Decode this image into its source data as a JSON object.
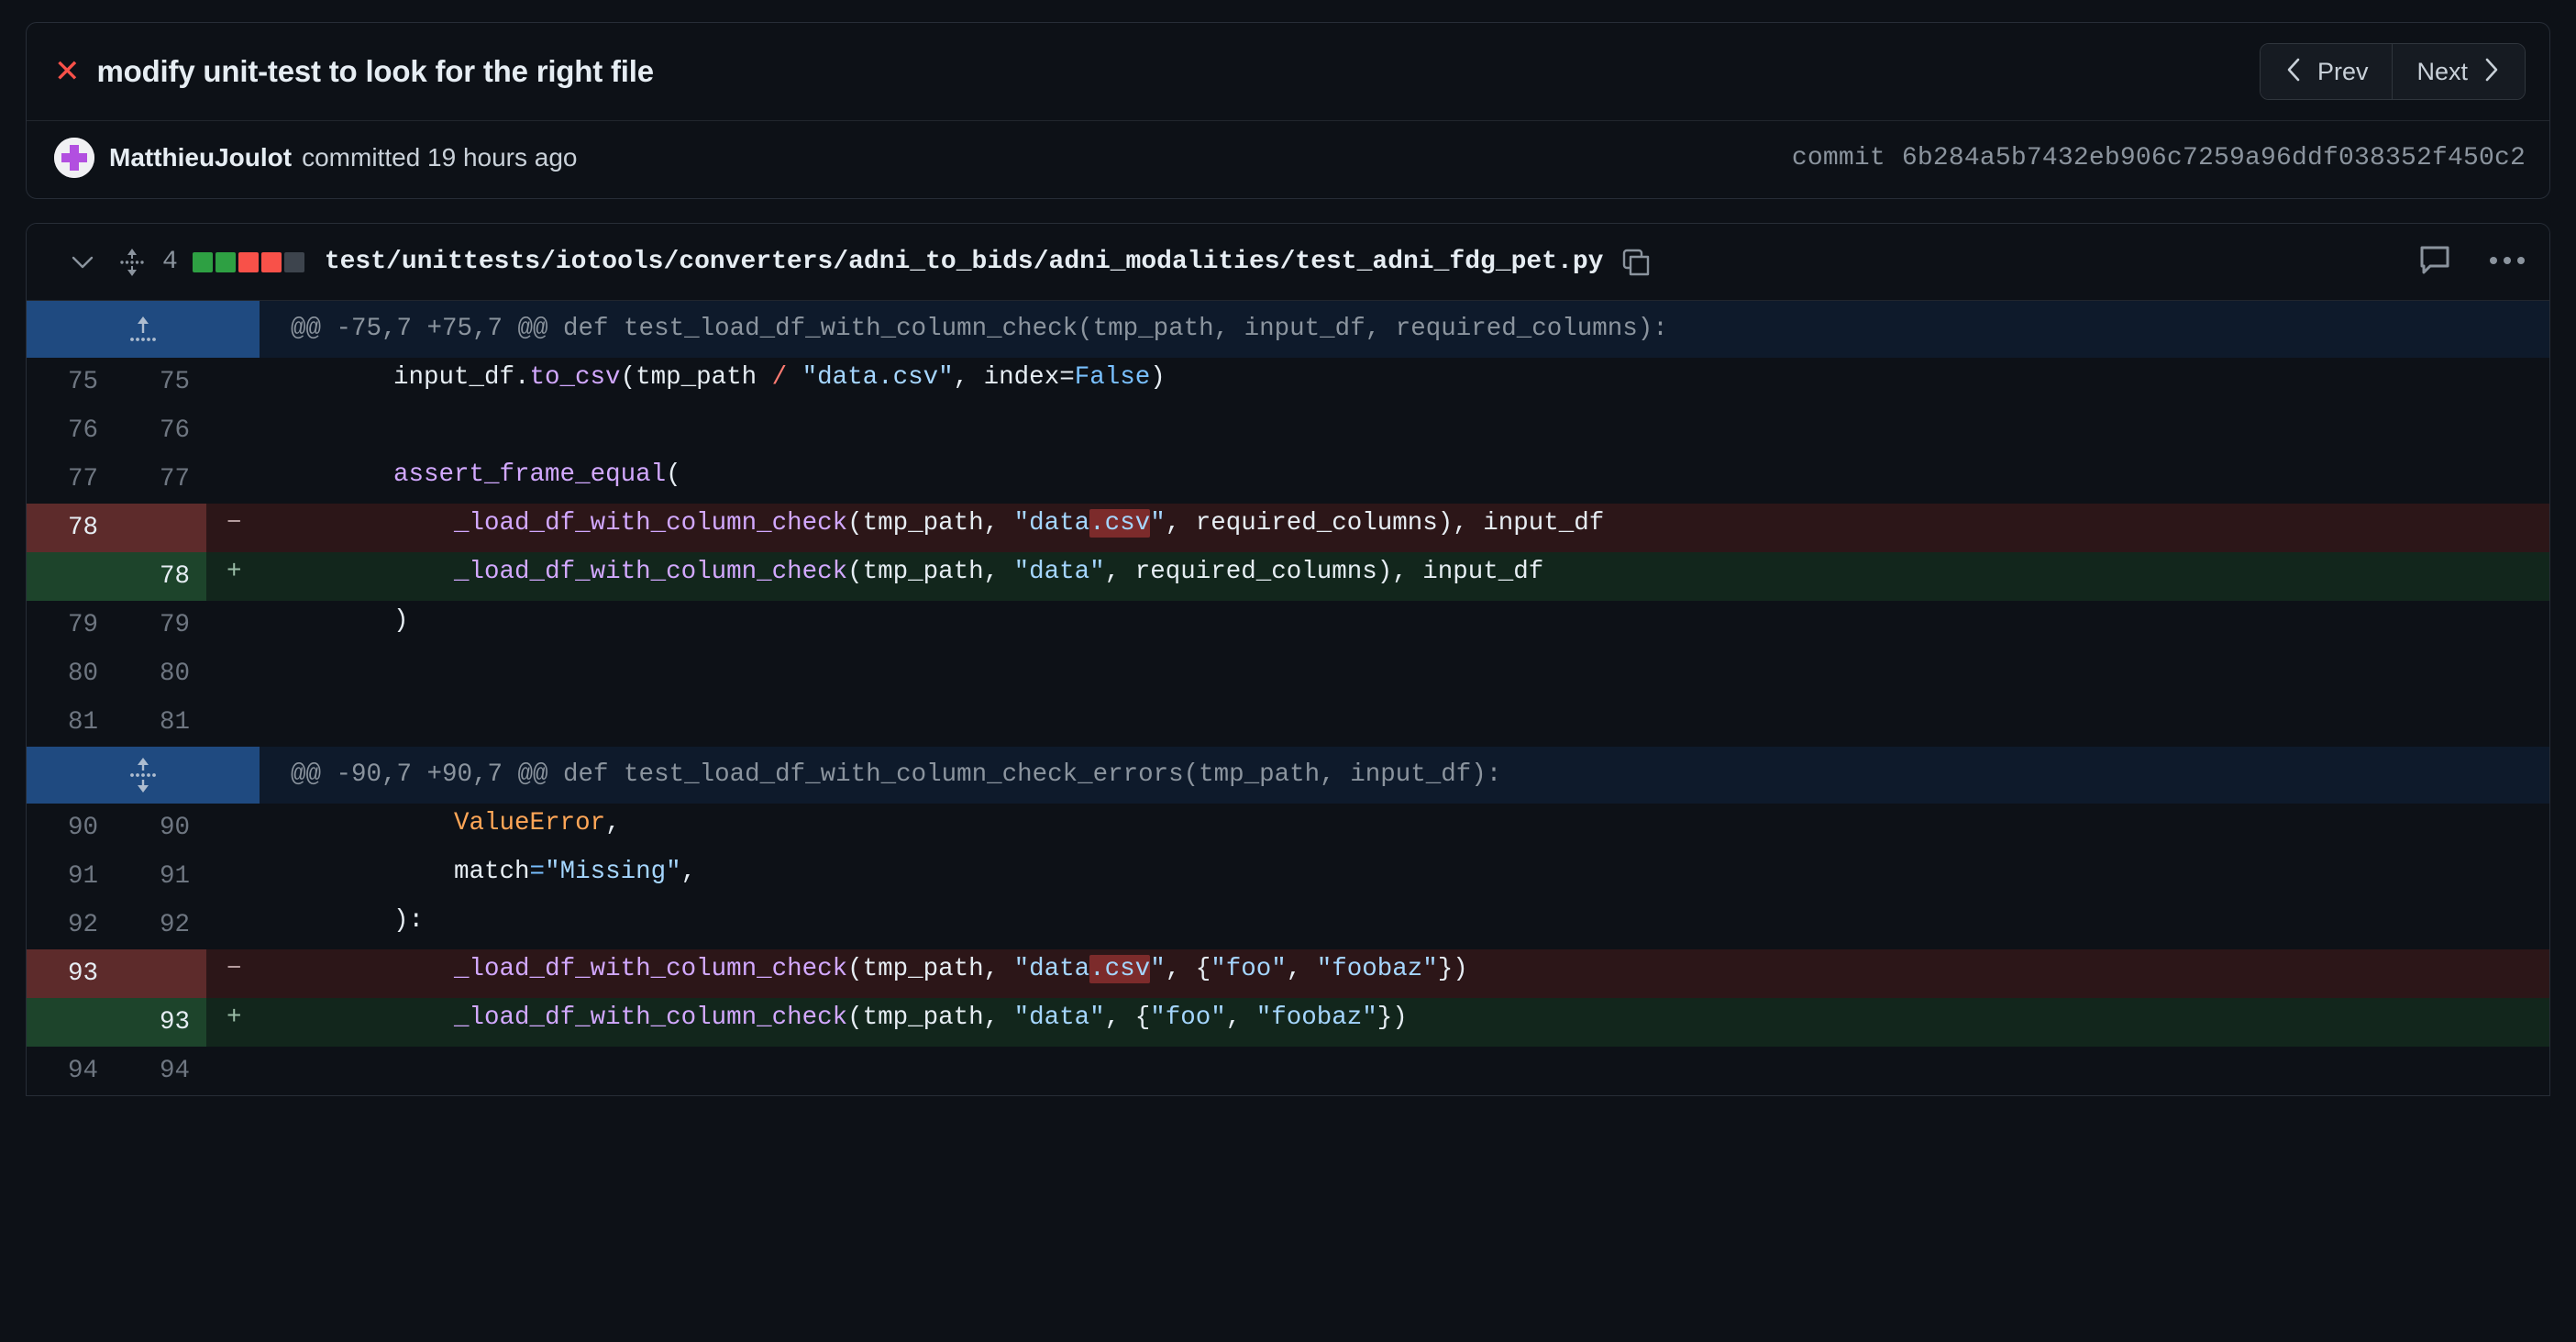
{
  "commit": {
    "status_icon": "x-icon",
    "title": "modify unit-test to look for the right file",
    "author": "MatthieuJoulot",
    "committed_text": "committed 19 hours ago",
    "hash_label": "commit",
    "hash": "6b284a5b7432eb906c7259a96ddf038352f450c2",
    "prev_label": "Prev",
    "next_label": "Next",
    "prev_icon": "chevron-left-icon",
    "next_icon": "chevron-right-icon"
  },
  "file": {
    "collapse_icon": "chevron-down-icon",
    "move_icon": "move-updown-icon",
    "changes_count": "4",
    "diffstat_blocks": [
      "#2ea043",
      "#2ea043",
      "#f85149",
      "#f85149",
      "#3d444d"
    ],
    "path": "test/unittests/iotools/converters/adni_to_bids/adni_modalities/test_adni_fdg_pet.py",
    "copy_icon": "copy-icon",
    "comment_icon": "comment-icon",
    "menu_icon": "kebab-menu-icon"
  },
  "hunks": [
    {
      "expander_icon": "expand-up-icon",
      "header": "@@ -75,7 +75,7 @@ def test_load_df_with_column_check(tmp_path, input_df, required_columns):",
      "lines": [
        {
          "type": "ctx",
          "old": "75",
          "new": "75",
          "marker": ""
        },
        {
          "type": "ctx",
          "old": "76",
          "new": "76",
          "marker": ""
        },
        {
          "type": "ctx",
          "old": "77",
          "new": "77",
          "marker": ""
        },
        {
          "type": "del",
          "old": "78",
          "new": "",
          "marker": "−"
        },
        {
          "type": "add",
          "old": "",
          "new": "78",
          "marker": "+"
        },
        {
          "type": "ctx",
          "old": "79",
          "new": "79",
          "marker": ""
        },
        {
          "type": "ctx",
          "old": "80",
          "new": "80",
          "marker": ""
        },
        {
          "type": "ctx",
          "old": "81",
          "new": "81",
          "marker": ""
        }
      ],
      "code_text": [
        "        input_df.to_csv(tmp_path / \"data.csv\", index=False)",
        "",
        "        assert_frame_equal(",
        "            _load_df_with_column_check(tmp_path, \"data.csv\", required_columns), input_df",
        "            _load_df_with_column_check(tmp_path, \"data\", required_columns), input_df",
        "        )",
        "",
        ""
      ]
    },
    {
      "expander_icon": "expand-updown-icon",
      "header": "@@ -90,7 +90,7 @@ def test_load_df_with_column_check_errors(tmp_path, input_df):",
      "lines": [
        {
          "type": "ctx",
          "old": "90",
          "new": "90",
          "marker": ""
        },
        {
          "type": "ctx",
          "old": "91",
          "new": "91",
          "marker": ""
        },
        {
          "type": "ctx",
          "old": "92",
          "new": "92",
          "marker": ""
        },
        {
          "type": "del",
          "old": "93",
          "new": "",
          "marker": "−"
        },
        {
          "type": "add",
          "old": "",
          "new": "93",
          "marker": "+"
        },
        {
          "type": "ctx",
          "old": "94",
          "new": "94",
          "marker": ""
        }
      ],
      "code_text": [
        "            ValueError,",
        "            match=\"Missing\",",
        "        ):",
        "            _load_df_with_column_check(tmp_path, \"data.csv\", {\"foo\", \"foobaz\"})",
        "            _load_df_with_column_check(tmp_path, \"data\", {\"foo\", \"foobaz\"})",
        ""
      ]
    }
  ]
}
